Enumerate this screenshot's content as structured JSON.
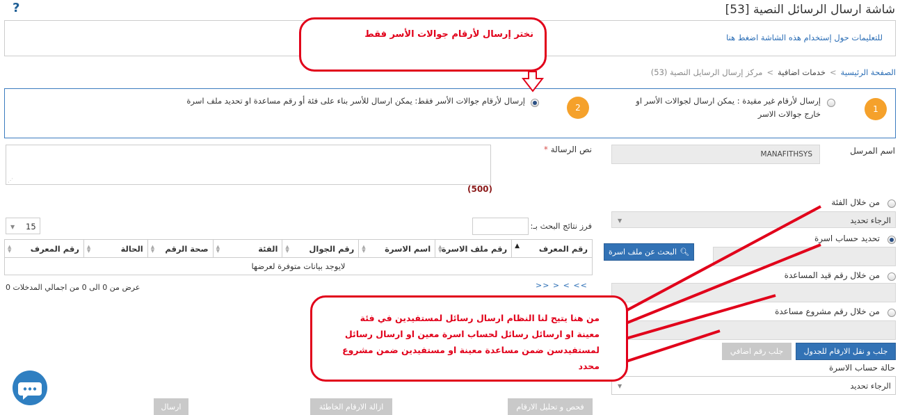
{
  "header": {
    "title": "شاشة ارسال الرسائل النصية [53]",
    "help_icon": "?",
    "instructions_link": "للتعليمات حول إستخدام هذه الشاشة اضغط هنا"
  },
  "breadcrumb": {
    "home": "الصفحة الرئيسية",
    "section": "خدمات اضافية",
    "current": "مركز إرسال الرسايل النصية (53)",
    "separator": ">"
  },
  "options": {
    "step1": "1",
    "step1_label": "إرسال لأرقام غير مقيدة : يمكن ارسال لجوالات الأسر او خارج جوالات الاسر",
    "step2": "2",
    "step2_label": "إرسال لأرقام جوالات الأسر فقط: يمكن ارسال للأسر بناء على فئة أو رقم مساعدة او تحديد ملف اسرة"
  },
  "form": {
    "sender_label": "اسم المرسل",
    "sender_value": "MANAFITHSYS",
    "message_label": "نص الرسالة",
    "required_mark": "*",
    "char_count": "(500)",
    "by_category_label": "من خلال الفئة",
    "by_category_select": "الرجاء تحديد",
    "family_account_label": "تحديد حساب اسرة",
    "search_family_button": "البحث عن ملف اسرة",
    "by_aid_number_label": "من خلال رقم قيد المساعدة",
    "by_project_label": "من خلال رقم مشروع مساعدة",
    "fetch_numbers_button": "جلب و نقل الارقام للجدول",
    "fetch_extra_button": "جلب رقم اضافي",
    "account_status_label": "حالة حساب الاسرة",
    "account_status_select": "الرجاء تحديد"
  },
  "table": {
    "filter_label": "فرز نتائج البحث بـ:",
    "page_size": "15",
    "columns": [
      "رقم المعرف",
      "رقم ملف الاسرة",
      "اسم الاسرة",
      "رقم الجوال",
      "الفئة",
      "صحة الرقم",
      "الحالة",
      "رقم المعرف"
    ],
    "empty_message": "لايوجد بيانات متوفرة لعرضها",
    "pager": ">> > < <<",
    "summary": "عرض من 0 الى 0 من اجمالي المدخلات 0"
  },
  "actions": {
    "check_numbers": "فحص و تحليل الارقام",
    "remove_wrong": "ازالة الارقام الخاطئة",
    "send": "ارسال"
  },
  "annotations": {
    "top_callout": "نختر إرسال لأرقام جوالات الأسر فقط",
    "bottom_callout": "من هنا يتيح لنا النظام ارسال رسائل لمستفيدين في فئة معينة او ارسائل رسائل لحساب اسرة معين او ارسال رسائل لمستفيدسن ضمن مساعدة معينة او مستفيدين ضمن مشروع محدد",
    "accent_color": "#e1001a"
  }
}
